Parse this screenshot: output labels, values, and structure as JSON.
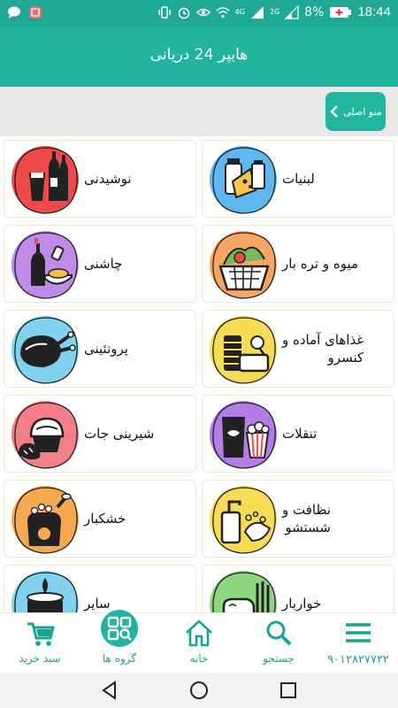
{
  "status_bar": {
    "time": "18:44",
    "battery": "8%",
    "network_a": "4G",
    "network_b": "2G"
  },
  "app_bar": {
    "title": "هایپر 24 دریانی"
  },
  "menu": {
    "main_menu_label": "منو اصلی"
  },
  "categories": [
    {
      "label_line1": "لبنیات",
      "label_line2": "",
      "icon": "dairy-icon",
      "color": "#5fb7f0"
    },
    {
      "label_line1": "نوشیدنی",
      "label_line2": "",
      "icon": "drinks-icon",
      "color": "#ef4a4a"
    },
    {
      "label_line1": "میوه و تره بار",
      "label_line2": "",
      "icon": "fruit-basket-icon",
      "color": "#f7a663"
    },
    {
      "label_line1": "چاشنی",
      "label_line2": "",
      "icon": "condiments-icon",
      "color": "#c08ae8"
    },
    {
      "label_line1": "غذاهای آماده و",
      "label_line2": "کنسرو",
      "icon": "canned-food-icon",
      "color": "#f8dc55"
    },
    {
      "label_line1": "پروتئینی",
      "label_line2": "",
      "icon": "chicken-icon",
      "color": "#7fd3ee"
    },
    {
      "label_line1": "تنقلات",
      "label_line2": "",
      "icon": "snacks-icon",
      "color": "#b27ee6"
    },
    {
      "label_line1": "شیرینی جات",
      "label_line2": "",
      "icon": "pastry-icon",
      "color": "#f27f87"
    },
    {
      "label_line1": "نظافت و",
      "label_line2": "شستشو",
      "icon": "cleaning-icon",
      "color": "#f8dc55"
    },
    {
      "label_line1": "خشکبار",
      "label_line2": "",
      "icon": "nuts-icon",
      "color": "#f7a950"
    },
    {
      "label_line1": "خواربار",
      "label_line2": "",
      "icon": "groceries-icon",
      "color": "#8ed67f"
    },
    {
      "label_line1": "سایر",
      "label_line2": "",
      "icon": "other-icon",
      "color": "#7fd3ee"
    }
  ],
  "bottom_nav": {
    "items": [
      {
        "label": "سبد خرید",
        "icon": "cart-icon"
      },
      {
        "label": "گروه ها",
        "icon": "groups-icon"
      },
      {
        "label": "خانه",
        "icon": "home-icon"
      },
      {
        "label": "جستجو",
        "icon": "search-icon"
      },
      {
        "label": "۹۰۱۲۸۲۷۷۲۲",
        "icon": "menu-icon"
      }
    ],
    "active_index": 1
  },
  "colors": {
    "primary": "#21b5a0",
    "status": "#1fa895",
    "accent_text": "#19a48f"
  }
}
